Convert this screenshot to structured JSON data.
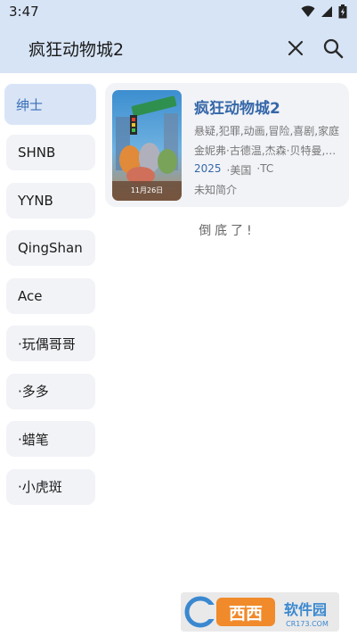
{
  "status": {
    "time": "3:47"
  },
  "search": {
    "query": "疯狂动物城2"
  },
  "icons": {
    "close": "close-icon",
    "search": "search-icon",
    "wifi": "wifi-icon",
    "signal": "signal-icon",
    "battery": "battery-icon"
  },
  "sidebar": {
    "items": [
      {
        "label": "绅士"
      },
      {
        "label": "SHNB"
      },
      {
        "label": "YYNB"
      },
      {
        "label": "QingShan"
      },
      {
        "label": "Ace"
      },
      {
        "label": "·玩偶哥哥"
      },
      {
        "label": "·多多"
      },
      {
        "label": "·蜡笔"
      },
      {
        "label": "·小虎斑"
      }
    ]
  },
  "result": {
    "title": "疯狂动物城2",
    "genres": "悬疑,犯罪,动画,冒险,喜剧,家庭",
    "cast": "金妮弗·古德温,杰森·贝特曼,关继威",
    "year": "2025",
    "region": "·美国",
    "quality": "·TC",
    "summary": "未知简介",
    "poster_date": "11月26日"
  },
  "footer": {
    "end_text": "倒底了!"
  },
  "watermark": {
    "text": "西西软件园",
    "url": "CR173.COM"
  },
  "colors": {
    "accent": "#3567a8",
    "header_bg": "#d7e4f5",
    "card_bg": "#f2f3f7"
  }
}
